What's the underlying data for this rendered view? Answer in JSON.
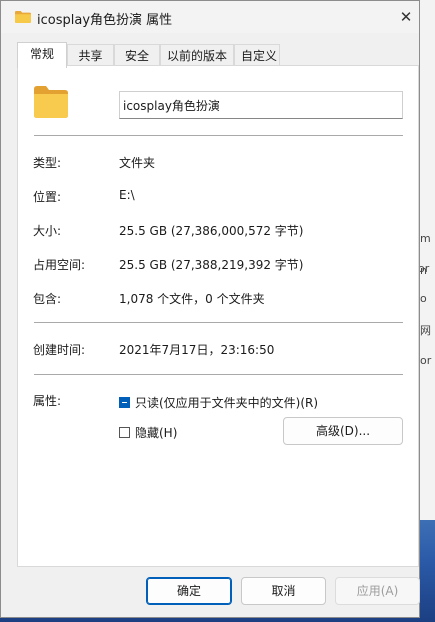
{
  "window": {
    "title": "icosplay角色扮演 属性",
    "close_glyph": "✕"
  },
  "tabs": [
    {
      "label": "常规",
      "active": true
    },
    {
      "label": "共享",
      "active": false
    },
    {
      "label": "安全",
      "active": false
    },
    {
      "label": "以前的版本",
      "active": false
    },
    {
      "label": "自定义",
      "active": false
    }
  ],
  "general": {
    "name_value": "icosplay角色扮演",
    "rows": {
      "type": {
        "label": "类型:",
        "value": "文件夹"
      },
      "location": {
        "label": "位置:",
        "value": "E:\\"
      },
      "size": {
        "label": "大小:",
        "value": "25.5 GB (27,386,000,572 字节)"
      },
      "size_on_disk": {
        "label": "占用空间:",
        "value": "25.5 GB (27,388,219,392 字节)"
      },
      "contains": {
        "label": "包含:",
        "value": "1,078 个文件，0 个文件夹"
      },
      "created": {
        "label": "创建时间:",
        "value": "2021年7月17日，23:16:50"
      }
    },
    "attributes": {
      "label": "属性:",
      "readonly": {
        "label": "只读(仅应用于文件夹中的文件)(R)",
        "state": "indeterminate"
      },
      "hidden": {
        "label": "隐藏(H)",
        "state": "unchecked"
      },
      "advanced_button": "高级(D)..."
    }
  },
  "footer": {
    "ok": "确定",
    "cancel": "取消",
    "apply": "应用(A)"
  },
  "background": {
    "right_fragments": [
      "m",
      "n",
      "or",
      "o",
      "网",
      "or"
    ]
  },
  "colors": {
    "accent": "#005fb8",
    "folder": "#f7c948"
  }
}
